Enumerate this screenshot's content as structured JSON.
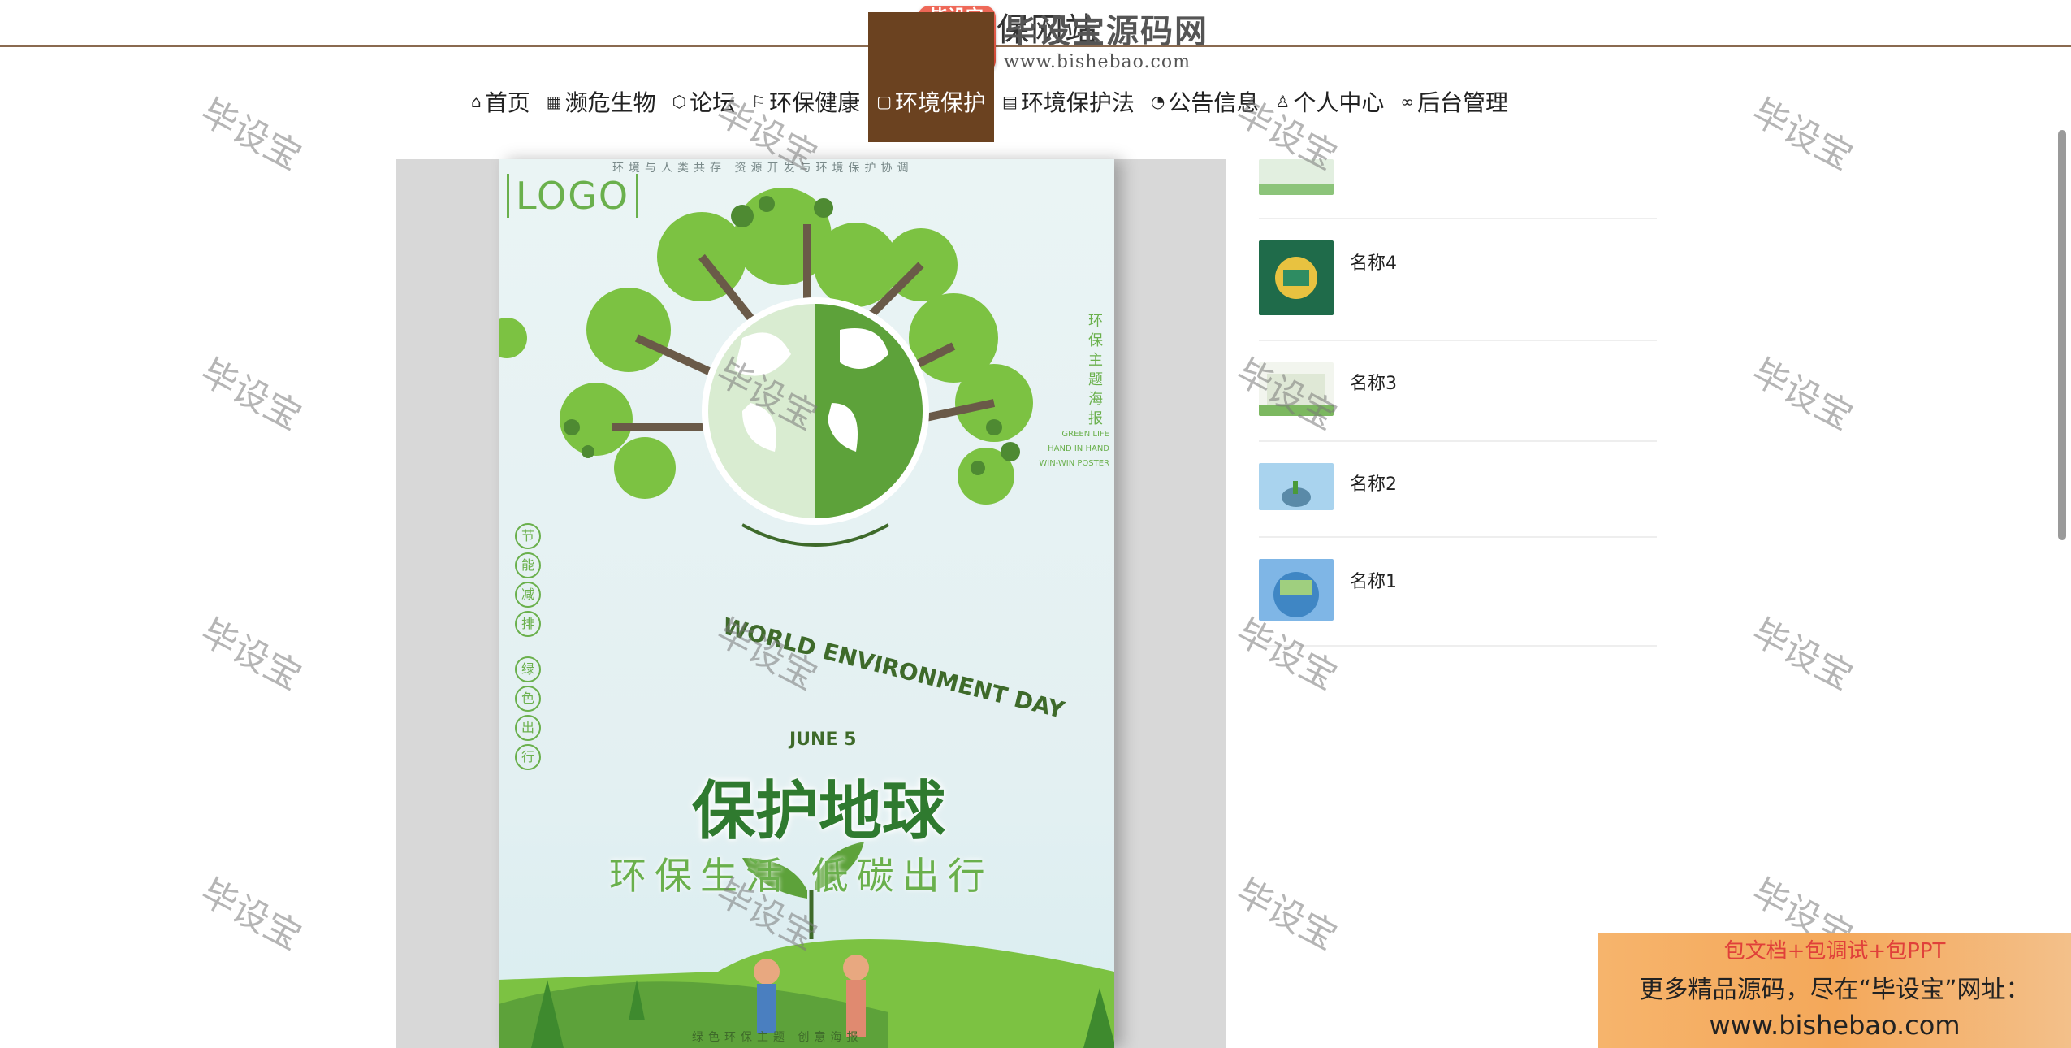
{
  "header": {
    "site_title": "环保网站",
    "brand_badge": "毕设宝",
    "brand_name": "毕设宝源码网",
    "brand_url": "www.bishebao.com"
  },
  "nav": [
    {
      "icon": "⌂",
      "label": "首页"
    },
    {
      "icon": "▦",
      "label": "濒危生物"
    },
    {
      "icon": "⬡",
      "label": "论坛"
    },
    {
      "icon": "⚐",
      "label": "环保健康"
    },
    {
      "icon": "▢",
      "label": "环境保护",
      "active": true
    },
    {
      "icon": "▤",
      "label": "环境保护法"
    },
    {
      "icon": "◔",
      "label": "公告信息"
    },
    {
      "icon": "♙",
      "label": "个人中心"
    },
    {
      "icon": "∞",
      "label": "后台管理"
    }
  ],
  "poster": {
    "logo": "LOGO",
    "top_line": "环境与人类共存 资源开发与环境保护协调",
    "day_text": "WORLD ENVIRONMENT DAY",
    "date": "JUNE 5",
    "main_title": "保护地球",
    "subtitle": "环保生活 低碳出行",
    "badges": [
      "节",
      "能",
      "减",
      "排",
      "绿",
      "色",
      "出",
      "行"
    ],
    "vertical_title": "环保主题海报",
    "vertical_en": "GREEN LIFE HAND IN HAND WIN-WIN POSTER",
    "bottom_line": "绿色环保主题 创意海报"
  },
  "list": [
    {
      "name": ""
    },
    {
      "name": "名称4"
    },
    {
      "name": "名称3"
    },
    {
      "name": "名称2"
    },
    {
      "name": "名称1"
    }
  ],
  "watermark": "毕设宝",
  "ad": {
    "line1": "包文档+包调试+包PPT",
    "line2": "更多精品源码，尽在“毕设宝”网址：",
    "line3": "www.bishebao.com"
  }
}
